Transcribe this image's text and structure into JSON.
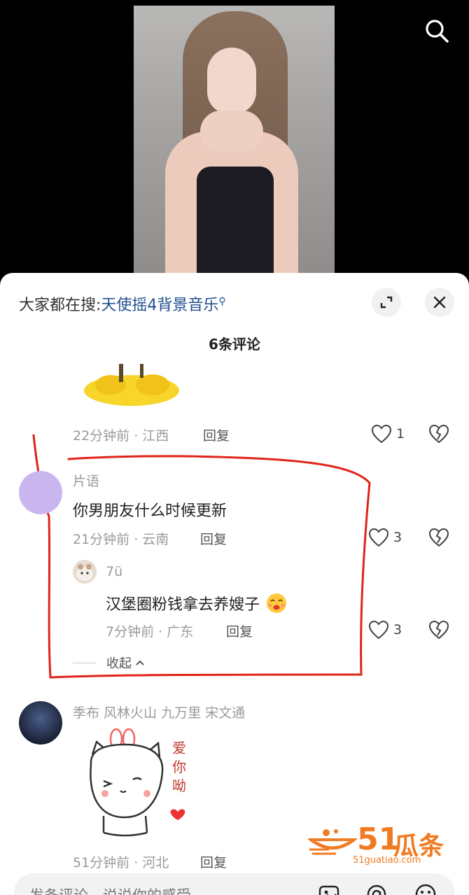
{
  "trending": {
    "prefix": "大家都在搜:",
    "keyword": "天使摇4背景音乐"
  },
  "comment_count": "6条评论",
  "comments": [
    {
      "meta": "22分钟前 · 江西",
      "reply": "回复",
      "likes": "1"
    },
    {
      "name": "片语",
      "text": "你男朋友什么时候更新",
      "meta": "21分钟前 · 云南",
      "reply": "回复",
      "likes": "3",
      "sub_reply": {
        "name": "7ü",
        "text": "汉堡圈粉钱拿去养嫂子",
        "meta": "7分钟前 · 广东",
        "reply": "回复",
        "likes": "3"
      },
      "collapse": "收起"
    },
    {
      "name": "季布 风林火山 九万里 宋文通",
      "sticker_text": "爱你呦",
      "meta": "51分钟前 · 河北",
      "reply": "回复"
    }
  ],
  "watermark": {
    "num": "51",
    "text": "瓜条",
    "url": "51guatiao.com"
  },
  "input": {
    "placeholder": "发条评论，说说你的感受"
  },
  "colors": {
    "accent_blue": "#1f4f8f",
    "annotation_red": "#e0231a",
    "watermark_orange": "#f07b22"
  },
  "icons": [
    "search-icon",
    "expand-icon",
    "close-icon",
    "heart-icon",
    "broken-heart-icon",
    "image-icon",
    "at-icon",
    "emoji-icon"
  ]
}
